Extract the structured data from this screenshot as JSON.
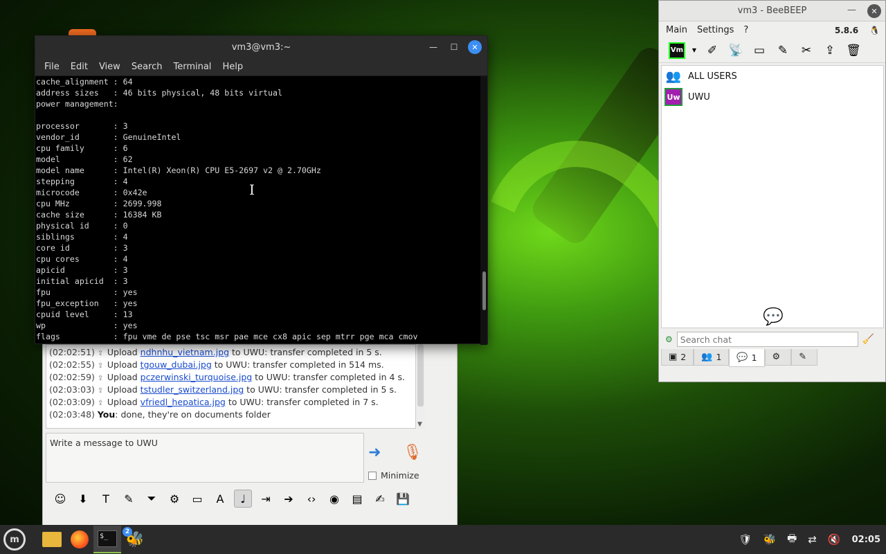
{
  "terminal": {
    "title": "vm3@vm3:~",
    "menu": [
      "File",
      "Edit",
      "View",
      "Search",
      "Terminal",
      "Help"
    ],
    "lines": [
      "cache_alignment : 64",
      "address sizes   : 46 bits physical, 48 bits virtual",
      "power management:",
      "",
      "processor       : 3",
      "vendor_id       : GenuineIntel",
      "cpu family      : 6",
      "model           : 62",
      "model name      : Intel(R) Xeon(R) CPU E5-2697 v2 @ 2.70GHz",
      "stepping        : 4",
      "microcode       : 0x42e",
      "cpu MHz         : 2699.998",
      "cache size      : 16384 KB",
      "physical id     : 0",
      "siblings        : 4",
      "core id         : 3",
      "cpu cores       : 4",
      "apicid          : 3",
      "initial apicid  : 3",
      "fpu             : yes",
      "fpu_exception   : yes",
      "cpuid level     : 13",
      "wp              : yes",
      "flags           : fpu vme de pse tsc msr pae mce cx8 apic sep mtrr pge mca cmov"
    ]
  },
  "chat": {
    "log": [
      {
        "time": "(02:02:51)",
        "pre": "Upload ",
        "file": "ndhnhu_vietnam.jpg",
        "post": " to UWU: transfer completed in 5 s."
      },
      {
        "time": "(02:02:55)",
        "pre": "Upload ",
        "file": "tgouw_dubai.jpg",
        "post": " to UWU: transfer completed in 514 ms."
      },
      {
        "time": "(02:02:59)",
        "pre": "Upload ",
        "file": "pczerwinski_turquoise.jpg",
        "post": " to UWU: transfer completed in 4 s."
      },
      {
        "time": "(02:03:03)",
        "pre": "Upload ",
        "file": "tstudler_switzerland.jpg",
        "post": " to UWU: transfer completed in 5 s."
      },
      {
        "time": "(02:03:09)",
        "pre": "Upload ",
        "file": "vfriedl_hepatica.jpg",
        "post": " to UWU: transfer completed in 7 s."
      }
    ],
    "last_message": {
      "time": "(02:03:48)",
      "sender": "You",
      "text": ": done, they're on documents folder"
    },
    "input_placeholder": "Write a message to UWU",
    "minimize_label": "Minimize"
  },
  "beebeep": {
    "title": "vm3 - BeeBEEP",
    "menu": [
      "Main",
      "Settings",
      "?"
    ],
    "version": "5.8.6",
    "vm_label": "Vm",
    "users": [
      {
        "name": "ALL USERS"
      },
      {
        "name": "UWU",
        "avatar": "Uw"
      }
    ],
    "search_placeholder": "Search chat",
    "tabs": [
      {
        "icon": "▣",
        "count": "2"
      },
      {
        "icon": "👥",
        "count": "1"
      },
      {
        "icon": "💬",
        "count": "1"
      },
      {
        "icon": "⚙",
        "count": ""
      },
      {
        "icon": "✎",
        "count": ""
      }
    ]
  },
  "taskbar": {
    "clock": "02:05",
    "bee_badge": "2",
    "mint_label": "m"
  }
}
